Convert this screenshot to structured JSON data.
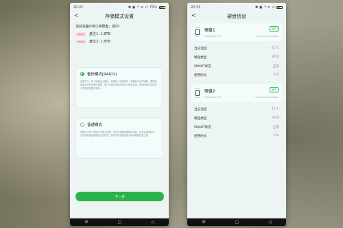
{
  "left_phone": {
    "status": {
      "time": "20:21",
      "icons": "✱ ▣ ⇡ ≋ .ıl",
      "battery": "75%",
      "battery_level": 0.75
    },
    "title": "存储模式设置",
    "intro": "当前设备中有2块硬盘，其中：",
    "disks": [
      {
        "badge": "未初始化",
        "label": "盘位1: 1.8TB"
      },
      {
        "badge": "未初始化",
        "label": "盘位2: 1.8TB"
      }
    ],
    "modes": [
      {
        "label": "备份模式[RAID1]",
        "selected": true,
        "description": "该模式下，两个硬盘互为备份，即使任一硬盘损坏，数据仍可正常读取，更换新硬盘后可恢复备份数据。用户可用存储空间为单个硬盘容量，即两块盘中容量较小的那块硬盘的容量。"
      },
      {
        "label": "普通模式",
        "selected": false,
        "description": "该模式下两个硬盘作为独立的盘，没有互相备份数据的功能，如发生硬盘损坏，已损坏的硬盘数据将无法恢复。用户可用存储空间为两块硬盘容量之和。"
      }
    ],
    "next_label": "下一步",
    "nav": [
      "☰",
      "▢",
      "◁"
    ]
  },
  "right_phone": {
    "status": {
      "time": "22:31",
      "icons": "✱ ▣ ⇡ ≋ .ıl",
      "battery": "",
      "battery_level": 0.6
    },
    "title": "硬盘信息",
    "disks": [
      {
        "name": "硬盘1",
        "status": "运行",
        "serial": "S9L3M6BL1.8TB",
        "model": "ST2000VN004-2E4164",
        "rows": [
          {
            "label": "当前温度",
            "value": "45°C"
          },
          {
            "label": "硬盘类型",
            "value": "HDD"
          },
          {
            "label": "SMART状态",
            "value": "正常"
          },
          {
            "label": "使用时长",
            "value": "22h"
          }
        ]
      },
      {
        "name": "硬盘2",
        "status": "运行",
        "serial": "S9L3M6BL1.8TB",
        "model": "ST2000VN004-2E4164",
        "rows": [
          {
            "label": "当前温度",
            "value": "45°C"
          },
          {
            "label": "硬盘类型",
            "value": "HDD"
          },
          {
            "label": "SMART状态",
            "value": "正常"
          },
          {
            "label": "使用时长",
            "value": "22h"
          }
        ]
      }
    ],
    "nav": [
      "☰",
      "▢",
      "◁"
    ]
  }
}
